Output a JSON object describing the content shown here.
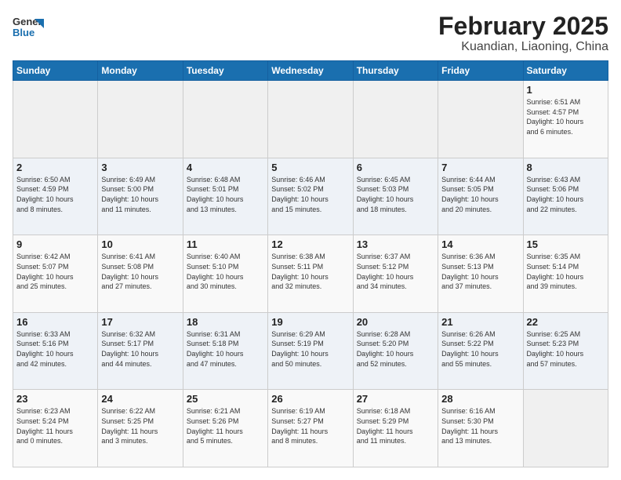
{
  "app": {
    "logo_general": "General",
    "logo_blue": "Blue",
    "title": "February 2025",
    "subtitle": "Kuandian, Liaoning, China"
  },
  "calendar": {
    "days_of_week": [
      "Sunday",
      "Monday",
      "Tuesday",
      "Wednesday",
      "Thursday",
      "Friday",
      "Saturday"
    ],
    "weeks": [
      [
        {
          "day": "",
          "info": ""
        },
        {
          "day": "",
          "info": ""
        },
        {
          "day": "",
          "info": ""
        },
        {
          "day": "",
          "info": ""
        },
        {
          "day": "",
          "info": ""
        },
        {
          "day": "",
          "info": ""
        },
        {
          "day": "1",
          "info": "Sunrise: 6:51 AM\nSunset: 4:57 PM\nDaylight: 10 hours\nand 6 minutes."
        }
      ],
      [
        {
          "day": "2",
          "info": "Sunrise: 6:50 AM\nSunset: 4:59 PM\nDaylight: 10 hours\nand 8 minutes."
        },
        {
          "day": "3",
          "info": "Sunrise: 6:49 AM\nSunset: 5:00 PM\nDaylight: 10 hours\nand 11 minutes."
        },
        {
          "day": "4",
          "info": "Sunrise: 6:48 AM\nSunset: 5:01 PM\nDaylight: 10 hours\nand 13 minutes."
        },
        {
          "day": "5",
          "info": "Sunrise: 6:46 AM\nSunset: 5:02 PM\nDaylight: 10 hours\nand 15 minutes."
        },
        {
          "day": "6",
          "info": "Sunrise: 6:45 AM\nSunset: 5:03 PM\nDaylight: 10 hours\nand 18 minutes."
        },
        {
          "day": "7",
          "info": "Sunrise: 6:44 AM\nSunset: 5:05 PM\nDaylight: 10 hours\nand 20 minutes."
        },
        {
          "day": "8",
          "info": "Sunrise: 6:43 AM\nSunset: 5:06 PM\nDaylight: 10 hours\nand 22 minutes."
        }
      ],
      [
        {
          "day": "9",
          "info": "Sunrise: 6:42 AM\nSunset: 5:07 PM\nDaylight: 10 hours\nand 25 minutes."
        },
        {
          "day": "10",
          "info": "Sunrise: 6:41 AM\nSunset: 5:08 PM\nDaylight: 10 hours\nand 27 minutes."
        },
        {
          "day": "11",
          "info": "Sunrise: 6:40 AM\nSunset: 5:10 PM\nDaylight: 10 hours\nand 30 minutes."
        },
        {
          "day": "12",
          "info": "Sunrise: 6:38 AM\nSunset: 5:11 PM\nDaylight: 10 hours\nand 32 minutes."
        },
        {
          "day": "13",
          "info": "Sunrise: 6:37 AM\nSunset: 5:12 PM\nDaylight: 10 hours\nand 34 minutes."
        },
        {
          "day": "14",
          "info": "Sunrise: 6:36 AM\nSunset: 5:13 PM\nDaylight: 10 hours\nand 37 minutes."
        },
        {
          "day": "15",
          "info": "Sunrise: 6:35 AM\nSunset: 5:14 PM\nDaylight: 10 hours\nand 39 minutes."
        }
      ],
      [
        {
          "day": "16",
          "info": "Sunrise: 6:33 AM\nSunset: 5:16 PM\nDaylight: 10 hours\nand 42 minutes."
        },
        {
          "day": "17",
          "info": "Sunrise: 6:32 AM\nSunset: 5:17 PM\nDaylight: 10 hours\nand 44 minutes."
        },
        {
          "day": "18",
          "info": "Sunrise: 6:31 AM\nSunset: 5:18 PM\nDaylight: 10 hours\nand 47 minutes."
        },
        {
          "day": "19",
          "info": "Sunrise: 6:29 AM\nSunset: 5:19 PM\nDaylight: 10 hours\nand 50 minutes."
        },
        {
          "day": "20",
          "info": "Sunrise: 6:28 AM\nSunset: 5:20 PM\nDaylight: 10 hours\nand 52 minutes."
        },
        {
          "day": "21",
          "info": "Sunrise: 6:26 AM\nSunset: 5:22 PM\nDaylight: 10 hours\nand 55 minutes."
        },
        {
          "day": "22",
          "info": "Sunrise: 6:25 AM\nSunset: 5:23 PM\nDaylight: 10 hours\nand 57 minutes."
        }
      ],
      [
        {
          "day": "23",
          "info": "Sunrise: 6:23 AM\nSunset: 5:24 PM\nDaylight: 11 hours\nand 0 minutes."
        },
        {
          "day": "24",
          "info": "Sunrise: 6:22 AM\nSunset: 5:25 PM\nDaylight: 11 hours\nand 3 minutes."
        },
        {
          "day": "25",
          "info": "Sunrise: 6:21 AM\nSunset: 5:26 PM\nDaylight: 11 hours\nand 5 minutes."
        },
        {
          "day": "26",
          "info": "Sunrise: 6:19 AM\nSunset: 5:27 PM\nDaylight: 11 hours\nand 8 minutes."
        },
        {
          "day": "27",
          "info": "Sunrise: 6:18 AM\nSunset: 5:29 PM\nDaylight: 11 hours\nand 11 minutes."
        },
        {
          "day": "28",
          "info": "Sunrise: 6:16 AM\nSunset: 5:30 PM\nDaylight: 11 hours\nand 13 minutes."
        },
        {
          "day": "",
          "info": ""
        }
      ]
    ]
  }
}
